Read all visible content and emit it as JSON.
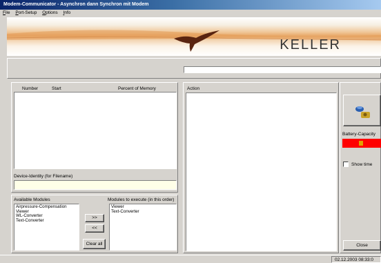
{
  "window": {
    "title": "Modem-Communicator - Asynchron dann Synchron mit Modem"
  },
  "menu": [
    {
      "label": "File",
      "key": "F",
      "rest": "ile"
    },
    {
      "label": "Port-Setup",
      "key": "P",
      "rest": "ort-Setup"
    },
    {
      "label": "Options",
      "key": "O",
      "rest": "ptions"
    },
    {
      "label": "Info",
      "key": "I",
      "rest": "nfo"
    }
  ],
  "banner": {
    "brand": "KELLER"
  },
  "records": {
    "col_number": "Number",
    "col_start": "Start",
    "col_percent": "Percent of Memory"
  },
  "device_identity": {
    "label": "Device-Identity (for Filename)",
    "value": ""
  },
  "modules": {
    "available_label": "Available Modules",
    "available": [
      "Airpressure-Compensation",
      "Viewer",
      "WL-Converter",
      "Text-Converter"
    ],
    "execute_label": "Modules to execute (in this order)",
    "execute": [
      "Viewer",
      "Text-Converter"
    ],
    "add_label": ">>",
    "remove_label": "<<",
    "clear_label": "Clear all"
  },
  "action": {
    "label": "Action"
  },
  "side": {
    "battery_label": "Battery-Capacity",
    "show_time_label": "Show time",
    "close_label": "Close"
  },
  "status": {
    "datetime": "02.12.2003 08:33:0"
  },
  "colors": {
    "battery_bar": "#ff0000",
    "battery_mark": "#e0a000",
    "identity_field": "#ffffe8"
  }
}
